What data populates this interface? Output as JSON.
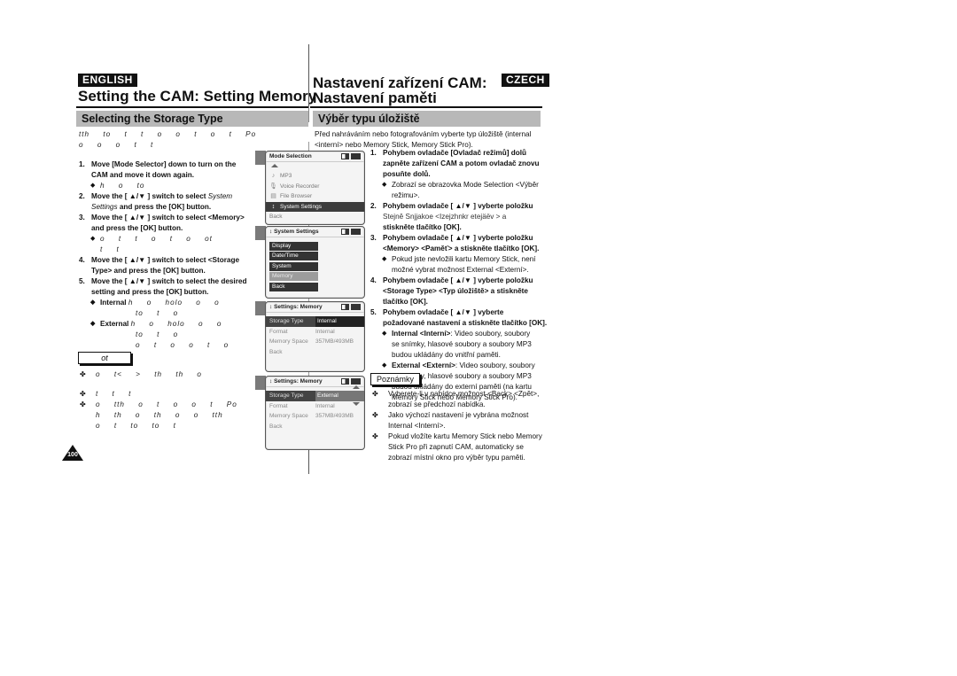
{
  "left": {
    "lang_badge": "ENGLISH",
    "title": "Setting the CAM: Setting Memory",
    "section": "Selecting the Storage Type",
    "intro": [
      "tth   to   t   t   o   o  t   o  t  Po",
      "o   o   o t   t"
    ],
    "steps": [
      {
        "num": "1.",
        "lines": [
          "Move [Mode Selector] down to turn on the",
          "CAM and move it down again."
        ]
      },
      {
        "num": "2.",
        "lines": [
          "Move the [ ▲/▼ ] switch to select ",
          "and press the [OK] button."
        ],
        "italic": [
          "System",
          "Settings"
        ]
      },
      {
        "num": "3.",
        "lines": [
          "Move the [ ▲/▼ ] switch to select <Memory>",
          "and press the [OK] button."
        ]
      },
      {
        "num": "4.",
        "lines": [
          "Move the [ ▲/▼ ] switch to select <Storage",
          "Type> and press the [OK] button."
        ]
      },
      {
        "num": "5.",
        "lines": [
          "Move the [ ▲/▼ ] switch to select the desired",
          "setting and press the [OK] button."
        ]
      }
    ],
    "sub_1": "h   o   to",
    "sub_3": [
      "o   t   t   o   t   o   ot",
      "t   t"
    ],
    "internal_label": "Internal",
    "internal_rest": [
      "h   o  holo   o  o",
      "to   t   o"
    ],
    "external_label": "External",
    "external_rest": [
      "h   o  holo   o  o",
      "to   t   o",
      "o  t  o   o  t  o"
    ],
    "notes_label": "ot",
    "notes": [
      [
        "o   t<   >  th   th   o"
      ],
      [
        "t   t   t"
      ],
      [
        "o   tth   o  t  o   o  t  Po",
        "h  th   o  th  o   o tth",
        "o  t   to   to  t"
      ]
    ],
    "page_number": "100"
  },
  "right": {
    "lang_badge": "CZECH",
    "title_line1": "Nastavení zařízení CAM:",
    "title_line2": "Nastavení paměti",
    "section": "Výběr typu úložiště",
    "intro": [
      "Před nahráváním nebo fotografováním vyberte typ úložiště (internal",
      "<interní> nebo Memory Stick, Memory Stick Pro)."
    ],
    "steps": [
      {
        "num": "1.",
        "lines": [
          "Pohybem ovladače [Ovladač režimů] dolů",
          "zapněte zařízení CAM a potom ovladač znovu",
          "posuňte dolů."
        ]
      },
      {
        "num": "2.",
        "lines": [
          "Pohybem ovladače [ ▲/▼ ] vyberte položku",
          "Stejně Snjjakoe   <Izejzhnkr etejäëv   > a",
          "stiskněte tlačítko [OK]."
        ]
      },
      {
        "num": "3.",
        "lines": [
          "Pohybem ovladače [ ▲/▼ ] vyberte položku",
          "<Memory> <Paměť> a stiskněte tlačítko [OK]."
        ]
      },
      {
        "num": "4.",
        "lines": [
          "Pohybem ovladače [ ▲/▼ ] vyberte položku",
          "<Storage Type> <Typ úložiště> a stiskněte",
          "tlačítko [OK]."
        ]
      },
      {
        "num": "5.",
        "lines": [
          "Pohybem ovladače [ ▲/▼ ] vyberte",
          "požadované nastavení a stiskněte tlačítko [OK]."
        ]
      }
    ],
    "sub_1": [
      "Zobrazí se obrazovka Mode Selection <Výběr",
      "režimu>."
    ],
    "sub_3": [
      "Pokud jste nevložili kartu Memory Stick, není",
      "možné vybrat možnost External <Externí>."
    ],
    "internal_label": "Internal <Interní>",
    "internal_rest": [
      ": Video soubory, soubory",
      "se snímky, hlasové soubory a soubory MP3",
      "budou ukládány do vnitřní paměti."
    ],
    "external_label": "External <Externí>",
    "external_rest": [
      ": Video soubory, soubory",
      "se snímky, hlasové soubory a soubory MP3",
      "budou ukládány do externí paměti (na kartu",
      "Memory Stick nebo Memory Stick Pro)."
    ],
    "notes_label": "Poznámky",
    "notes": [
      [
        "Vyberete-li v nabídce možnost <Back> <Zpět>,",
        "zobrazí se předchozí nabídka."
      ],
      [
        "Jako výchozí nastavení je vybrána možnost",
        "Internal <Interní>."
      ],
      [
        "Pokud vložíte kartu Memory Stick nebo Memory",
        "Stick Pro při zapnutí CAM, automaticky se",
        "zobrazí místní okno pro výběr typu paměti."
      ]
    ]
  },
  "screens": {
    "mode_selection": {
      "title": "Mode Selection",
      "items": [
        {
          "icon": "music-note-icon",
          "glyph": "♪",
          "label": "MP3"
        },
        {
          "icon": "microphone-icon",
          "glyph": "♂",
          "label": "Voice Recorder"
        },
        {
          "icon": "file-icon",
          "glyph": "▤",
          "label": "File Browser"
        },
        {
          "icon": "settings-icon",
          "glyph": "↕",
          "label": "System Settings",
          "selected": true
        },
        {
          "icon": "",
          "glyph": "",
          "label": "Back"
        }
      ]
    },
    "system_settings": {
      "title": "System Settings",
      "items": [
        {
          "label": "Display"
        },
        {
          "label": "Date/Time"
        },
        {
          "label": "System"
        },
        {
          "label": "Memory",
          "selected": true
        },
        {
          "label": "Back"
        }
      ]
    },
    "memory_internal": {
      "title": "Settings: Memory",
      "rows": [
        {
          "key": "Storage Type",
          "value": "Internal",
          "selected": true
        },
        {
          "key": "Format",
          "value": "Internal"
        },
        {
          "key": "Memory Space",
          "value": "357MB/493MB"
        },
        {
          "key": "Back",
          "value": ""
        }
      ]
    },
    "memory_external": {
      "title": "Settings: Memory",
      "rows": [
        {
          "key": "Storage Type",
          "value": "External",
          "selected": true
        },
        {
          "key": "Format",
          "value": "Internal"
        },
        {
          "key": "Memory Space",
          "value": "357MB/493MB"
        },
        {
          "key": "Back",
          "value": ""
        }
      ]
    }
  }
}
